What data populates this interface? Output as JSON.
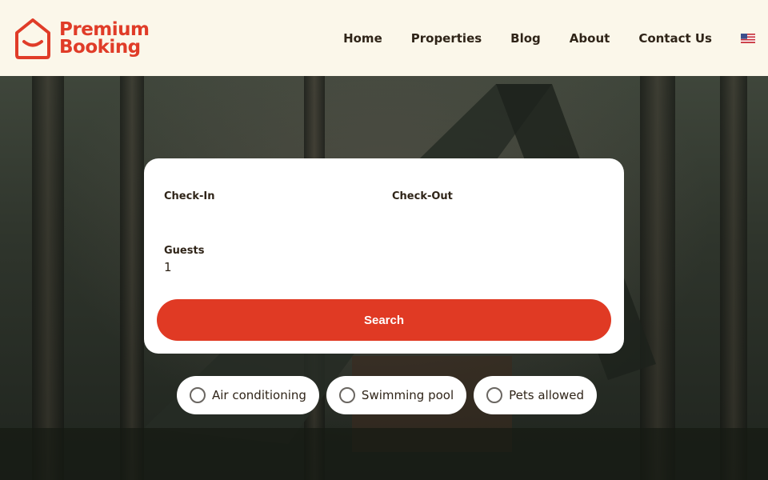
{
  "brand": {
    "line1": "Premium",
    "line2": "Booking",
    "color": "#e03c28"
  },
  "nav": {
    "items": [
      {
        "label": "Home"
      },
      {
        "label": "Properties"
      },
      {
        "label": "Blog"
      },
      {
        "label": "About"
      },
      {
        "label": "Contact Us"
      }
    ],
    "language_icon": "us-flag-icon"
  },
  "search": {
    "checkin_label": "Check-In",
    "checkin_value": "",
    "checkout_label": "Check-Out",
    "checkout_value": "",
    "guests_label": "Guests",
    "guests_value": "1",
    "button_label": "Search",
    "button_color": "#e03a24"
  },
  "filters": [
    {
      "label": "Air conditioning",
      "selected": false
    },
    {
      "label": "Swimming pool",
      "selected": false
    },
    {
      "label": "Pets allowed",
      "selected": false
    }
  ]
}
